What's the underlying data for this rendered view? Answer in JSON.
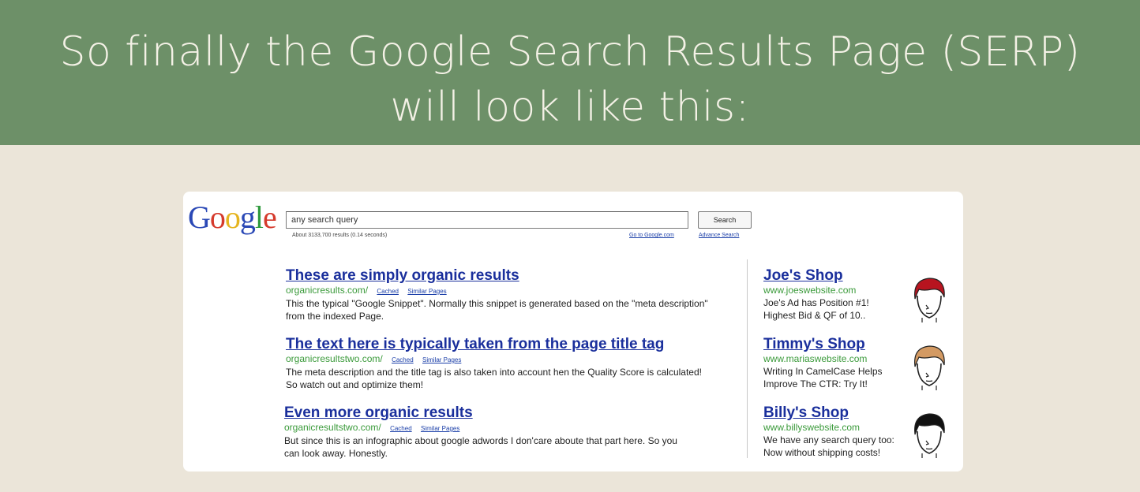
{
  "banner": {
    "line1": "So finally the Google Search Results Page (SERP)",
    "line2": "will look like this:"
  },
  "serp": {
    "logo_letters": [
      {
        "ch": "G",
        "color": "#2a48b6"
      },
      {
        "ch": "o",
        "color": "#d53a2c"
      },
      {
        "ch": "o",
        "color": "#e5b41f"
      },
      {
        "ch": "g",
        "color": "#2a48b6"
      },
      {
        "ch": "l",
        "color": "#2f9a3e"
      },
      {
        "ch": "e",
        "color": "#d53a2c"
      }
    ],
    "search_query": "any search query",
    "search_button": "Search",
    "stats": "About 3133,700 results (0.14 seconds)",
    "go_to_google": "Go to Google.com",
    "advanced_search": "Advance Search",
    "cached_label": "Cached",
    "similar_label": "Similar Pages",
    "results": [
      {
        "title": "These are simply organic results",
        "url": "organicresults.com/",
        "snippet": "This the typical \"Google Snippet\". Normally this snippet is generated based on the \"meta description\" from the indexed Page."
      },
      {
        "title": "The text here is typically taken from the page title tag",
        "url": "organicresultstwo.com/",
        "snippet": "The meta description and the title tag is also taken into account hen the Quality Score is calculated! So watch out and optimize them!"
      },
      {
        "title": "Even more organic results",
        "url": "organicresultstwo.com/",
        "snippet": "But since this is an infographic about google adwords I don'care aboute that part here. So you can look away. Honestly."
      }
    ],
    "ads": [
      {
        "title": "Joe's Shop",
        "url": "www.joeswebsite.com",
        "line1": "Joe's Ad has Position #1!",
        "line2": "Highest Bid & QF of 10..",
        "hair_color": "#b8141f"
      },
      {
        "title": "Timmy's Shop",
        "url": "www.mariaswebsite.com",
        "line1": "Writing In CamelCase Helps",
        "line2": "Improve The CTR: Try It!",
        "hair_color": "#d39a63"
      },
      {
        "title": "Billy's Shop",
        "url": "www.billyswebsite.com",
        "line1": "We have any search query too:",
        "line2": "Now without shipping costs!",
        "hair_color": "#111111"
      }
    ]
  }
}
